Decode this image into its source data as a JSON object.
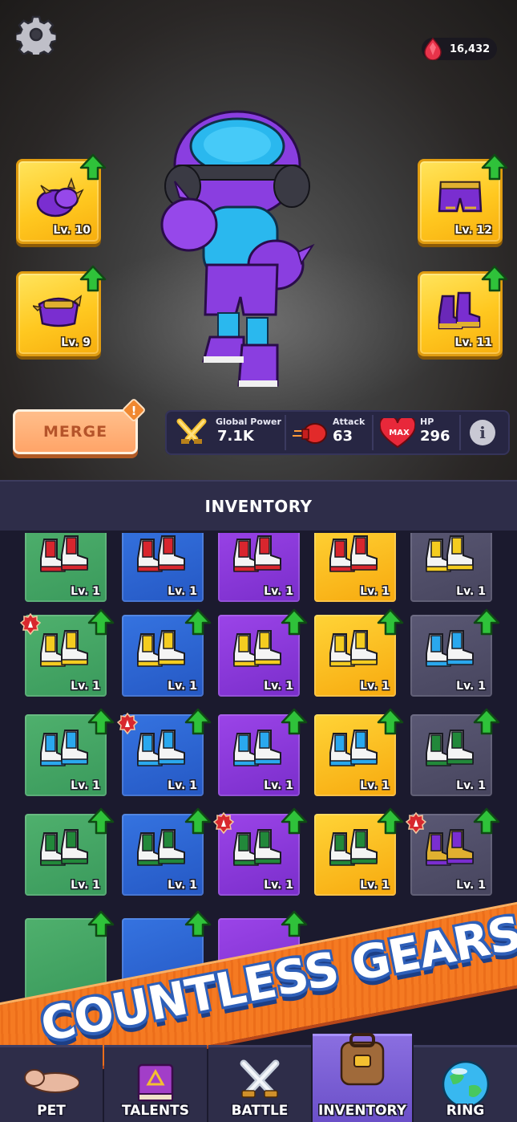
{
  "currency": {
    "icon": "gem-icon",
    "amount": "16,432"
  },
  "equipment": {
    "gloves": {
      "level": "Lv. 10"
    },
    "pants": {
      "level": "Lv. 12"
    },
    "belt": {
      "level": "Lv. 9"
    },
    "boots": {
      "level": "Lv. 11"
    }
  },
  "merge": {
    "label": "MERGE",
    "alert": "!"
  },
  "stats": {
    "power_label": "Global Power",
    "power_value": "7.1K",
    "attack_label": "Attack",
    "attack_value": "63",
    "hp_label": "HP",
    "hp_value": "296",
    "hp_icon_text": "MAX",
    "info_label": "i"
  },
  "inventory": {
    "title": "INVENTORY",
    "rows": [
      [
        {
          "color": "green",
          "item": "red-boots",
          "level": "Lv. 1",
          "upgrade": false,
          "new": false
        },
        {
          "color": "blue",
          "item": "red-boots",
          "level": "Lv. 1",
          "upgrade": false,
          "new": false
        },
        {
          "color": "purple",
          "item": "red-boots",
          "level": "Lv. 1",
          "upgrade": false,
          "new": false
        },
        {
          "color": "yellow",
          "item": "red-boots",
          "level": "Lv. 1",
          "upgrade": false,
          "new": false
        },
        {
          "color": "grey",
          "item": "yellow-boots",
          "level": "Lv. 1",
          "upgrade": false,
          "new": false
        }
      ],
      [
        {
          "color": "green",
          "item": "yellow-boots",
          "level": "Lv. 1",
          "upgrade": true,
          "new": true
        },
        {
          "color": "blue",
          "item": "yellow-boots",
          "level": "Lv. 1",
          "upgrade": true,
          "new": false
        },
        {
          "color": "purple",
          "item": "yellow-boots",
          "level": "Lv. 1",
          "upgrade": true,
          "new": false
        },
        {
          "color": "yellow",
          "item": "yellow-boots",
          "level": "Lv. 1",
          "upgrade": true,
          "new": false
        },
        {
          "color": "grey",
          "item": "blue-boots",
          "level": "Lv. 1",
          "upgrade": true,
          "new": false
        }
      ],
      [
        {
          "color": "green",
          "item": "blue-boots",
          "level": "Lv. 1",
          "upgrade": true,
          "new": false
        },
        {
          "color": "blue",
          "item": "blue-boots",
          "level": "Lv. 1",
          "upgrade": true,
          "new": true
        },
        {
          "color": "purple",
          "item": "blue-boots",
          "level": "Lv. 1",
          "upgrade": true,
          "new": false
        },
        {
          "color": "yellow",
          "item": "blue-boots",
          "level": "Lv. 1",
          "upgrade": true,
          "new": false
        },
        {
          "color": "grey",
          "item": "green-boots",
          "level": "Lv. 1",
          "upgrade": true,
          "new": false
        }
      ],
      [
        {
          "color": "green",
          "item": "green-boots",
          "level": "Lv. 1",
          "upgrade": true,
          "new": false
        },
        {
          "color": "blue",
          "item": "green-boots",
          "level": "Lv. 1",
          "upgrade": true,
          "new": false
        },
        {
          "color": "purple",
          "item": "green-boots",
          "level": "Lv. 1",
          "upgrade": true,
          "new": true
        },
        {
          "color": "yellow",
          "item": "green-boots",
          "level": "Lv. 1",
          "upgrade": true,
          "new": false
        },
        {
          "color": "grey",
          "item": "purple-boots",
          "level": "Lv. 1",
          "upgrade": true,
          "new": true
        }
      ]
    ]
  },
  "banner": {
    "headline": "COUNTLESS GEARS"
  },
  "nav": [
    {
      "id": "pet",
      "label": "PET",
      "icon": "pet-icon",
      "active": false
    },
    {
      "id": "talents",
      "label": "TALENTS",
      "icon": "book-icon",
      "active": false
    },
    {
      "id": "battle",
      "label": "BATTLE",
      "icon": "swords-icon",
      "active": false
    },
    {
      "id": "inventory",
      "label": "INVENTORY",
      "icon": "backpack-icon",
      "active": true
    },
    {
      "id": "ring",
      "label": "RING",
      "icon": "globe-icon",
      "active": false
    }
  ],
  "colors": {
    "green": "#4fb06d",
    "blue": "#3573e0",
    "purple": "#9b44e8",
    "yellow": "#ffd437",
    "grey": "#5a5874",
    "accent": "#ffa468",
    "upgrade_arrow": "#2fc23a"
  }
}
